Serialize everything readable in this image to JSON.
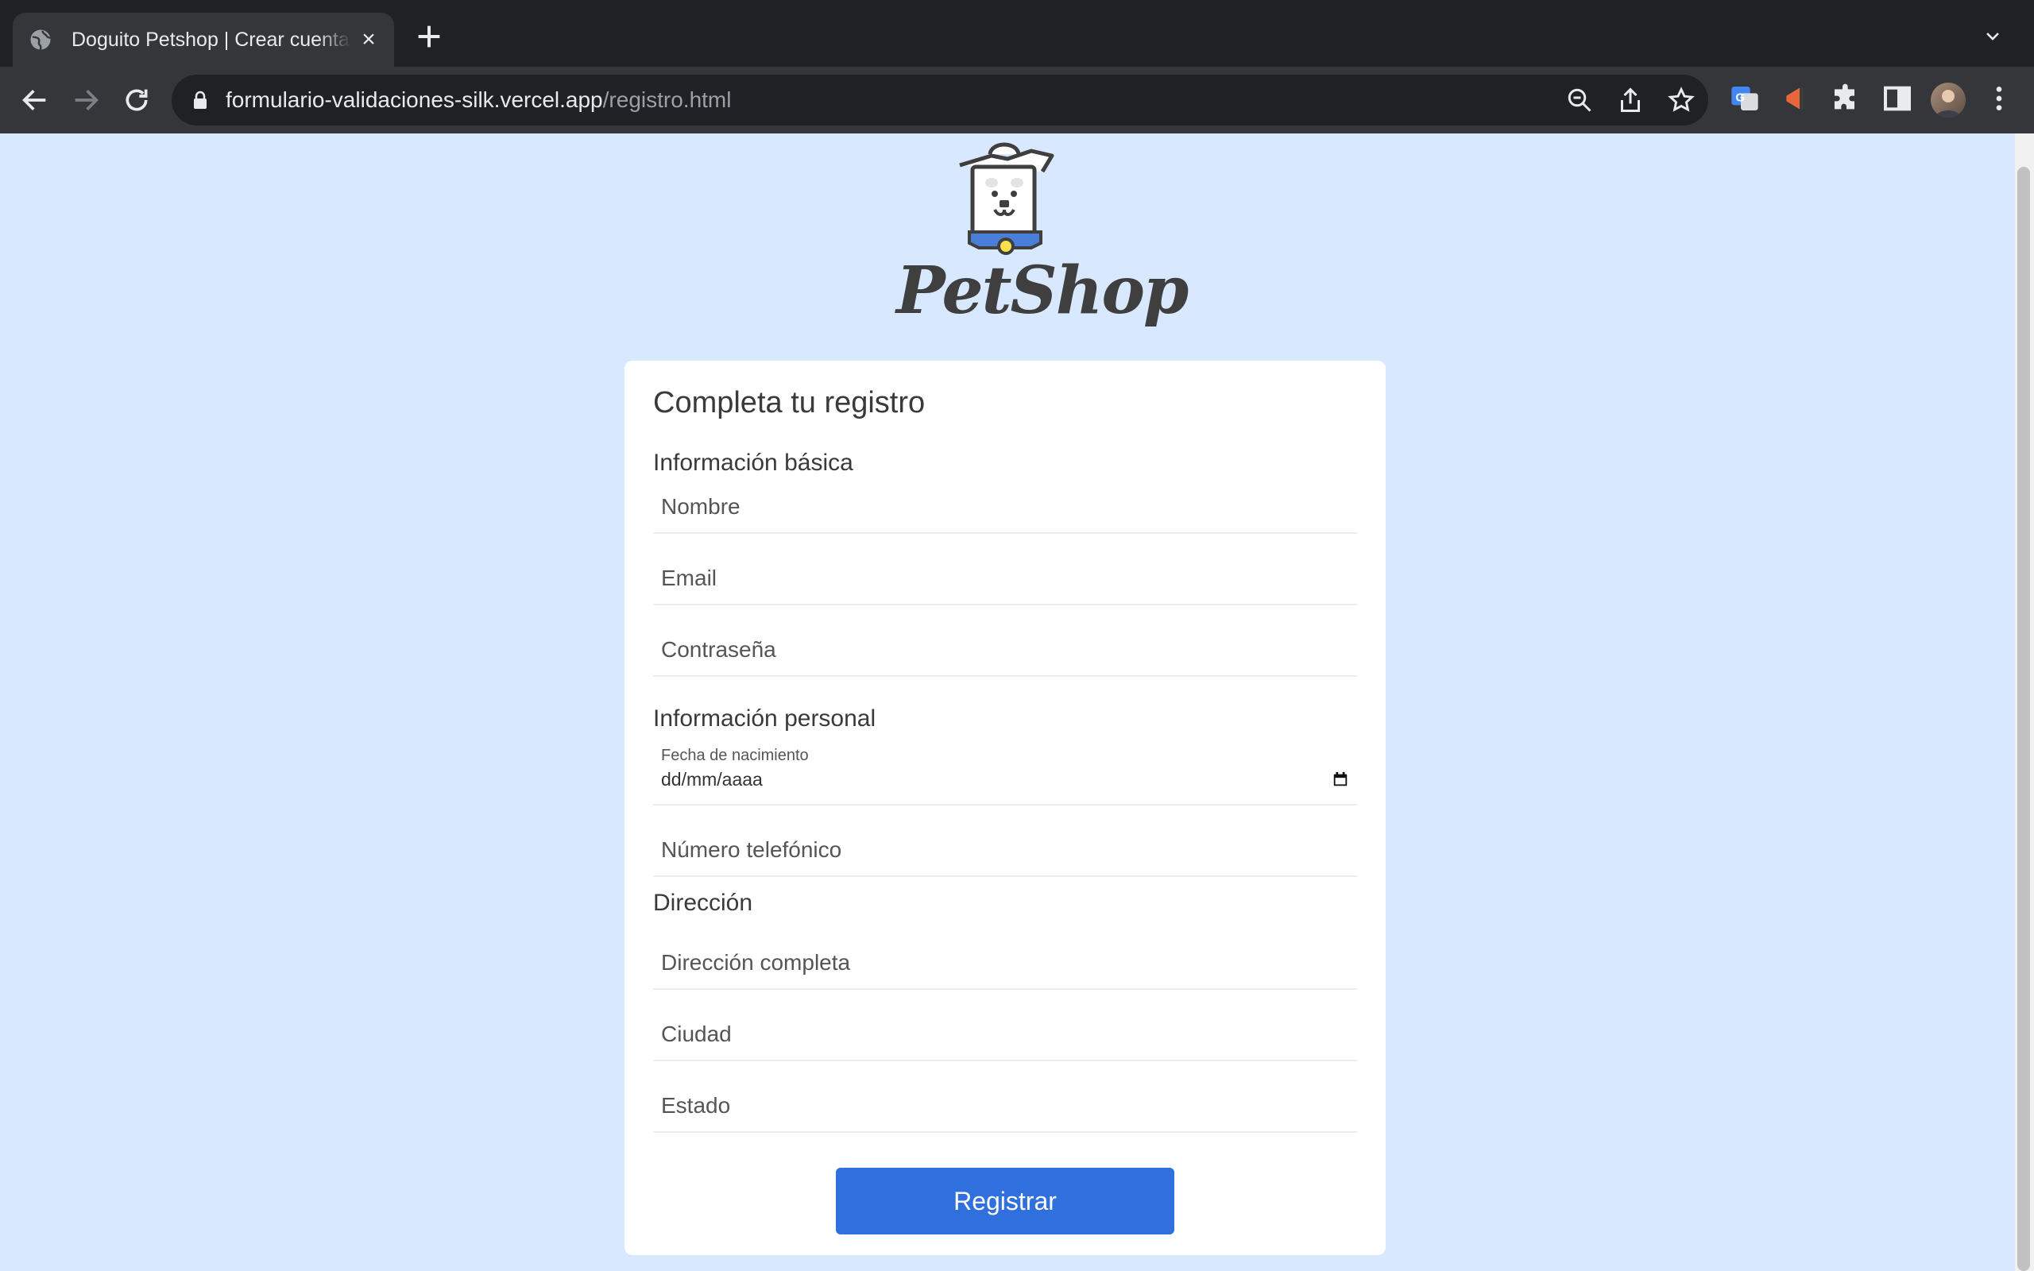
{
  "browser": {
    "tab_title": "Doguito Petshop | Crear cuenta",
    "url_host": "formulario-validaciones-silk.vercel.app",
    "url_path": "/registro.html"
  },
  "logo": {
    "text": "PetShop"
  },
  "form": {
    "title": "Completa tu registro",
    "sections": {
      "basic": "Información básica",
      "personal": "Información personal",
      "address": "Dirección"
    },
    "fields": {
      "nombre": {
        "placeholder": "Nombre",
        "value": ""
      },
      "email": {
        "placeholder": "Email",
        "value": ""
      },
      "password": {
        "placeholder": "Contraseña",
        "value": ""
      },
      "birthdate": {
        "label": "Fecha de nacimiento",
        "value": "dd/mm/aaaa"
      },
      "phone": {
        "placeholder": "Número telefónico",
        "value": ""
      },
      "address": {
        "placeholder": "Dirección completa",
        "value": ""
      },
      "city": {
        "placeholder": "Ciudad",
        "value": ""
      },
      "state": {
        "placeholder": "Estado",
        "value": ""
      }
    },
    "submit_label": "Registrar"
  },
  "colors": {
    "page_background": "#d8e8fe",
    "button": "#2f6fde",
    "chrome_dark": "#202124",
    "chrome_toolbar": "#35363a"
  },
  "icons": [
    "globe-icon",
    "close-icon",
    "plus-icon",
    "chevron-down-icon",
    "back-arrow-icon",
    "forward-arrow-icon",
    "reload-icon",
    "lock-icon",
    "zoom-out-icon",
    "share-icon",
    "star-icon",
    "translate-extension-icon",
    "extension-icon",
    "puzzle-icon",
    "side-panel-icon",
    "kebab-menu-icon",
    "calendar-icon"
  ]
}
